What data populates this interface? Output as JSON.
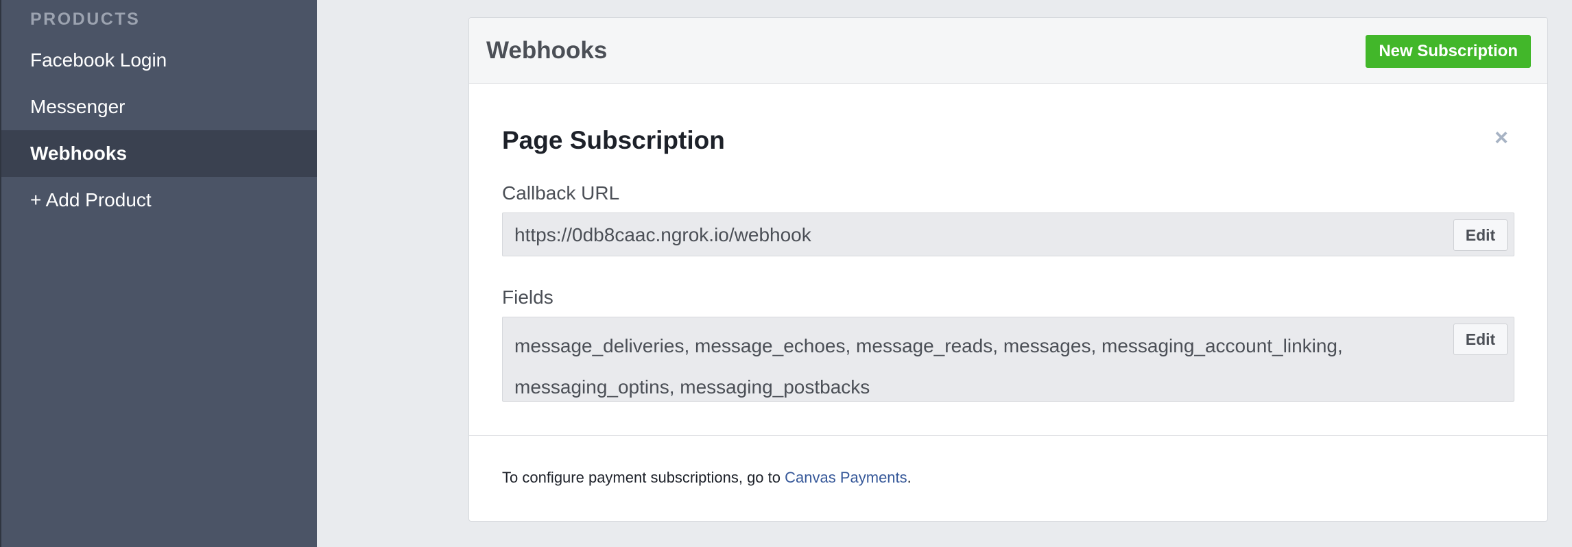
{
  "sidebar": {
    "heading": "PRODUCTS",
    "items": [
      {
        "label": "Facebook Login",
        "active": false
      },
      {
        "label": "Messenger",
        "active": false
      },
      {
        "label": "Webhooks",
        "active": true
      },
      {
        "label": "+ Add Product",
        "active": false
      }
    ]
  },
  "card": {
    "title": "Webhooks",
    "new_subscription_label": "New Subscription",
    "subscription": {
      "title": "Page Subscription",
      "close_icon": "close-icon",
      "callback_label": "Callback URL",
      "callback_value": "https://0db8caac.ngrok.io/webhook",
      "callback_edit_label": "Edit",
      "fields_label": "Fields",
      "fields_value": "message_deliveries, message_echoes, message_reads, messages, messaging_account_linking, messaging_optins, messaging_postbacks",
      "fields_edit_label": "Edit"
    },
    "footer": {
      "text_before": "To configure payment subscriptions, go to ",
      "link_text": "Canvas Payments",
      "text_after": "."
    }
  },
  "colors": {
    "sidebar_bg": "#4b5466",
    "sidebar_active_bg": "#3a4150",
    "primary_button": "#42b72a",
    "link": "#365899",
    "page_bg": "#e9ebee"
  }
}
